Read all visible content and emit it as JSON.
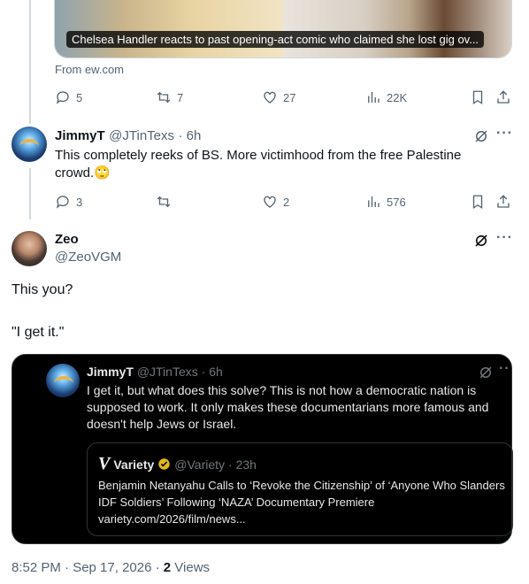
{
  "top_tweet": {
    "card_caption": "Chelsea Handler reacts to past opening-act comic who claimed she lost gig ov...",
    "from": "From ew.com",
    "replies": "5",
    "reposts": "7",
    "likes": "27",
    "views": "22K"
  },
  "reply1": {
    "name": "JimmyT",
    "handle": "@JTinTexs",
    "time": "· 6h",
    "text": "This completely reeks of BS.  More victimhood from the free Palestine crowd.🙄",
    "replies": "3",
    "reposts": "",
    "likes": "2",
    "views": "576"
  },
  "main_tweet": {
    "name": "Zeo",
    "handle": "@ZeoVGM",
    "line1": "This you?",
    "line2": "\"I get it.\"",
    "quote": {
      "name": "JimmyT",
      "handle": "@JTinTexs",
      "time": "· 6h",
      "text": "I get it, but what does this solve? This is not how a democratic nation is supposed to work.  It only makes these documentarians more famous and doesn't help Jews or Israel.",
      "inner": {
        "logo": "V",
        "name": "Variety",
        "handle": "@Variety",
        "time": "· 23h",
        "text": "Benjamin Netanyahu Calls to ‘Revoke the Citizenship’ of ‘Anyone Who Slanders IDF Soldiers’ Following ‘NAZA’ Documentary Premiere",
        "link": "variety.com/2026/film/news..."
      }
    },
    "timestamp": "8:52 PM · Sep 17, 2026 · ",
    "views_count": "2",
    "views_label": "Views"
  },
  "icons": {
    "reply": "reply-icon",
    "repost": "repost-icon",
    "like": "like-icon",
    "views": "views-icon",
    "bookmark": "bookmark-icon",
    "share": "share-icon",
    "grok": "grok-icon",
    "more": "more-icon",
    "verified": "verified-icon"
  }
}
